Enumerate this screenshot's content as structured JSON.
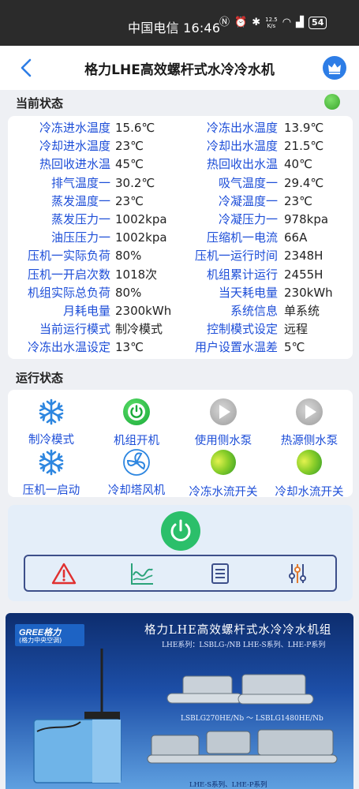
{
  "status_bar": {
    "carrier_time": "中国电信 16:46",
    "net_speed_value": "12.5",
    "net_speed_unit": "K/s",
    "battery": "54"
  },
  "header": {
    "title": "格力LHE高效螺杆式水冷冷水机",
    "back_icon": "chevron-left-icon",
    "right_icon": "crown-icon"
  },
  "current_status": {
    "label": "当前状态",
    "indicator_color": "#3aa52d",
    "rows": [
      {
        "l1": "冷冻进水温度",
        "v1": "15.6℃",
        "l2": "冷冻出水温度",
        "v2": "13.9℃"
      },
      {
        "l1": "冷却进水温度",
        "v1": "23℃",
        "l2": "冷却出水温度",
        "v2": "21.5℃"
      },
      {
        "l1": "热回收进水温",
        "v1": "45℃",
        "l2": "热回收出水温",
        "v2": "40℃"
      },
      {
        "l1": "排气温度一",
        "v1": "30.2℃",
        "l2": "吸气温度一",
        "v2": "29.4℃"
      },
      {
        "l1": "蒸发温度一",
        "v1": "23℃",
        "l2": "冷凝温度一",
        "v2": "23℃"
      },
      {
        "l1": "蒸发压力一",
        "v1": "1002kpa",
        "l2": "冷凝压力一",
        "v2": "978kpa"
      },
      {
        "l1": "油压压力一",
        "v1": "1002kpa",
        "l2": "压缩机一电流",
        "v2": "66A"
      },
      {
        "l1": "压机一实际负荷",
        "v1": "80%",
        "l2": "压机一运行时间",
        "v2": "2348H"
      },
      {
        "l1": "压机一开启次数",
        "v1": "1018次",
        "l2": "机组累计运行",
        "v2": "2455H"
      },
      {
        "l1": "机组实际总负荷",
        "v1": "80%",
        "l2": "当天耗电量",
        "v2": "230kWh"
      },
      {
        "l1": "月耗电量",
        "v1": "2300kWh",
        "l2": "系统信息",
        "v2": "单系统"
      },
      {
        "l1": "当前运行模式",
        "v1": "制冷模式",
        "l2": "控制模式设定",
        "v2": "远程"
      },
      {
        "l1": "冷冻出水温设定",
        "v1": "13℃",
        "l2": "用户设置水温差",
        "v2": "5℃"
      }
    ]
  },
  "run_status": {
    "label": "运行状态",
    "items": [
      {
        "label": "制冷模式",
        "icon": "snowflake-icon"
      },
      {
        "label": "机组开机",
        "icon": "power-on-icon"
      },
      {
        "label": "使用侧水泵",
        "icon": "pump-off-icon"
      },
      {
        "label": "热源侧水泵",
        "icon": "pump-off-icon"
      },
      {
        "label": "压机一启动",
        "icon": "snowflake-icon"
      },
      {
        "label": "冷却塔风机",
        "icon": "fan-icon"
      },
      {
        "label": "冷冻水流开关",
        "icon": "flow-switch-on-icon"
      },
      {
        "label": "冷却水流开关",
        "icon": "flow-switch-on-icon"
      }
    ]
  },
  "controls": {
    "power_icon": "power-icon",
    "tools": [
      "alarm-icon",
      "chart-icon",
      "document-icon",
      "settings-sliders-icon"
    ]
  },
  "banner": {
    "brand_name": "GREE格力",
    "brand_sub": "(格力中央空调)",
    "title": "格力LHE高效螺杆式水冷冷水机组",
    "subtitle": "LHE系列：LSBLG-/NB    LHE-S系列、LHE-P系列",
    "model_range": "LSBLG270HE/Nb ～ LSBLG1480HE/Nb",
    "bottom": "LHE-S系列、LHE-P系列"
  }
}
